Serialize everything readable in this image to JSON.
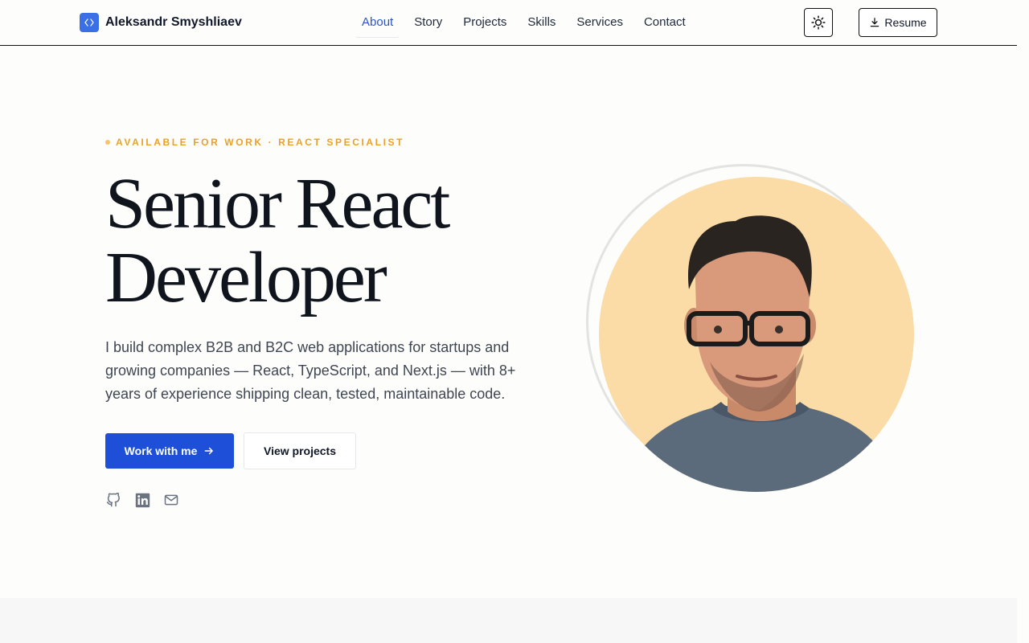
{
  "header": {
    "brand_name": "Aleksandr Smyshliaev",
    "nav": [
      {
        "label": "About",
        "active": true
      },
      {
        "label": "Story"
      },
      {
        "label": "Projects"
      },
      {
        "label": "Skills"
      },
      {
        "label": "Services"
      },
      {
        "label": "Contact"
      }
    ],
    "resume_label": "Resume",
    "theme_icon": "sun-icon"
  },
  "hero": {
    "eyebrow": "AVAILABLE FOR WORK · REACT SPECIALIST",
    "title_line1": "Senior React",
    "title_line2": "Developer",
    "description": "I build complex B2B and B2C web applications for startups and growing companies — React, TypeScript, and Next.js — with 8+ years of experience shipping clean, tested, maintainable code.",
    "primary_cta": "Work with me",
    "secondary_cta": "View projects",
    "socials": [
      "github-icon",
      "linkedin-icon",
      "mail-icon"
    ]
  },
  "colors": {
    "accent": "#1d4fd8",
    "eyebrow": "#e8a227",
    "portrait_bg": "#fbdba6"
  }
}
